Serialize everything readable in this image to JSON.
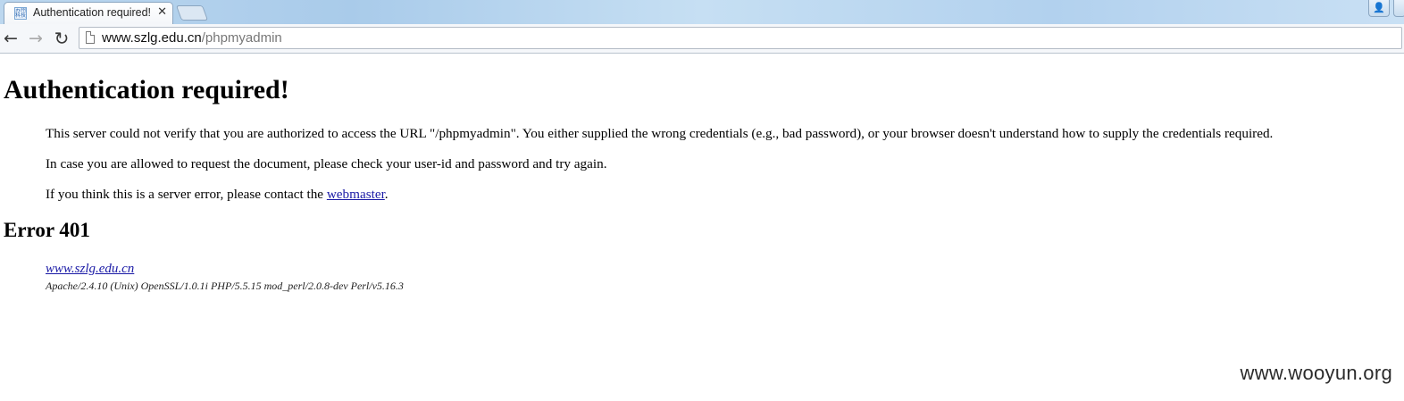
{
  "browser": {
    "tab": {
      "title": "Authentication required!",
      "close_glyph": "✕",
      "favicon_icon": "site-favicon-icon"
    },
    "nav": {
      "back_glyph": "←",
      "forward_glyph": "→",
      "reload_glyph": "↻"
    },
    "address_bar": {
      "host": "www.szlg.edu.cn",
      "path": "/phpmyadmin",
      "page_icon": "page-icon"
    },
    "profile_icon": "user-profile-icon"
  },
  "page": {
    "heading": "Authentication required!",
    "paragraph1": "This server could not verify that you are authorized to access the URL \"/phpmyadmin\". You either supplied the wrong credentials (e.g., bad password), or your browser doesn't understand how to supply the credentials required.",
    "paragraph2": "In case you are allowed to request the document, please check your user-id and password and try again.",
    "paragraph3_before": "If you think this is a server error, please contact the ",
    "paragraph3_link": "webmaster",
    "paragraph3_after": ".",
    "error_heading": "Error 401",
    "address_link": "www.szlg.edu.cn",
    "server_signature": "Apache/2.4.10 (Unix) OpenSSL/1.0.1i PHP/5.5.15 mod_perl/2.0.8-dev Perl/v5.16.3"
  },
  "watermark": "www.wooyun.org",
  "colors": {
    "link": "#1a1aa6",
    "titlebar": "#b7d4ee"
  }
}
